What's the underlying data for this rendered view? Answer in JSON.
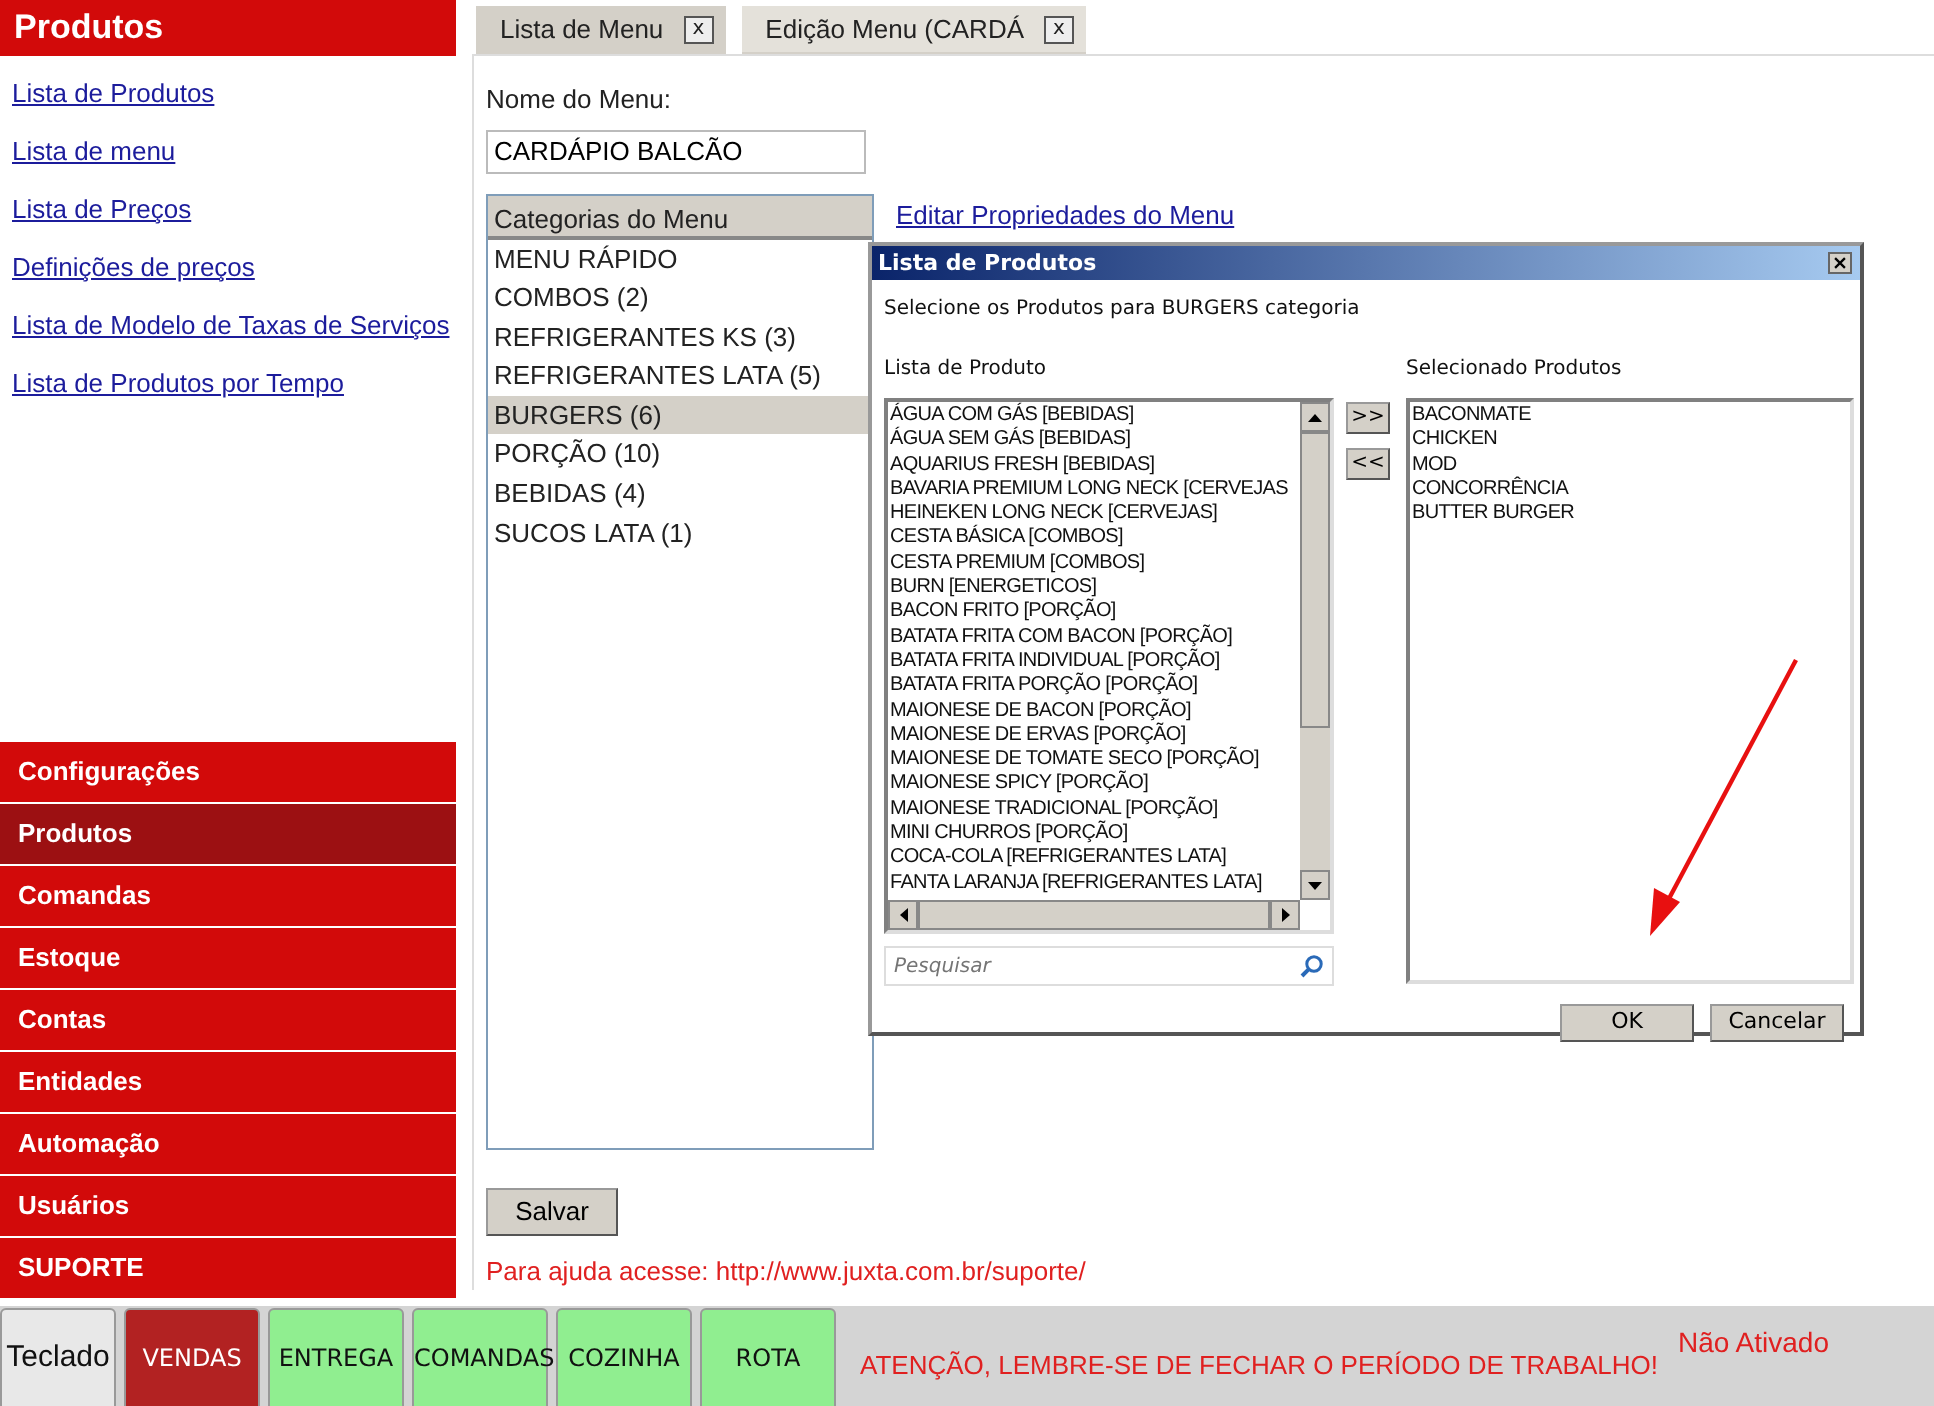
{
  "sidebar": {
    "title": "Produtos",
    "links": [
      "Lista de Produtos",
      "Lista de menu",
      "Lista de Preços",
      "Definições de preços",
      "Lista de Modelo de Taxas de Serviços",
      "Lista de Produtos por Tempo"
    ],
    "sections": [
      {
        "label": "Configurações",
        "selected": false
      },
      {
        "label": "Produtos",
        "selected": true
      },
      {
        "label": "Comandas",
        "selected": false
      },
      {
        "label": "Estoque",
        "selected": false
      },
      {
        "label": "Contas",
        "selected": false
      },
      {
        "label": "Entidades",
        "selected": false
      },
      {
        "label": "Automação",
        "selected": false
      },
      {
        "label": "Usuários",
        "selected": false
      },
      {
        "label": "SUPORTE",
        "selected": false
      }
    ]
  },
  "tabs": [
    {
      "label": "Lista de Menu",
      "close": "x",
      "selected": false
    },
    {
      "label": "Edição Menu (CARDÁ",
      "close": "x",
      "selected": true
    }
  ],
  "form": {
    "name_label": "Nome do Menu:",
    "name_value": "CARDÁPIO BALCÃO",
    "categories_header": "Categorias do Menu",
    "categories": [
      {
        "label": "MENU RÁPIDO",
        "selected": false
      },
      {
        "label": "COMBOS (2)",
        "selected": false
      },
      {
        "label": "REFRIGERANTES KS (3)",
        "selected": false
      },
      {
        "label": "REFRIGERANTES LATA (5)",
        "selected": false
      },
      {
        "label": "BURGERS (6)",
        "selected": true
      },
      {
        "label": "PORÇÃO (10)",
        "selected": false
      },
      {
        "label": "BEBIDAS (4)",
        "selected": false
      },
      {
        "label": "SUCOS LATA (1)",
        "selected": false
      }
    ],
    "edit_link": "Editar Propriedades do Menu",
    "save_button": "Salvar",
    "help_text": "Para ajuda acesse: http://www.juxta.com.br/suporte/"
  },
  "dialog": {
    "title": "Lista de Produtos",
    "instruction": "Selecione os Produtos para BURGERS categoria",
    "available_label": "Lista de Produto",
    "available": [
      "ÁGUA COM GÁS [BEBIDAS]",
      "ÁGUA SEM GÁS [BEBIDAS]",
      "AQUARIUS FRESH [BEBIDAS]",
      "BAVARIA PREMIUM LONG NECK [CERVEJAS",
      "HEINEKEN LONG NECK [CERVEJAS]",
      "CESTA BÁSICA [COMBOS]",
      "CESTA PREMIUM [COMBOS]",
      "BURN [ENERGETICOS]",
      "BACON FRITO [PORÇÃO]",
      "BATATA FRITA COM BACON [PORÇÃO]",
      "BATATA FRITA INDIVIDUAL [PORÇÃO]",
      "BATATA FRITA PORÇÃO [PORÇÃO]",
      "MAIONESE DE BACON [PORÇÃO]",
      "MAIONESE DE ERVAS [PORÇÃO]",
      "MAIONESE DE TOMATE SECO [PORÇÃO]",
      "MAIONESE SPICY [PORÇÃO]",
      "MAIONESE TRADICIONAL [PORÇÃO]",
      "MINI CHURROS [PORÇÃO]",
      "COCA-COLA [REFRIGERANTES LATA]",
      "FANTA LARANJA [REFRIGERANTES LATA]"
    ],
    "add_button": ">>",
    "remove_button": "<<",
    "selected_label": "Selecionado Produtos",
    "selected_products": [
      "BACONMATE",
      "CHICKEN",
      "MOD",
      "CONCORRÊNCIA",
      "BUTTER BURGER"
    ],
    "search": {
      "placeholder": "Pesquisar"
    },
    "ok_button": "OK",
    "cancel_button": "Cancelar"
  },
  "bottom_bar": {
    "buttons": [
      {
        "label": "Teclado",
        "kind": "keyboard",
        "selected": false
      },
      {
        "label": "VENDAS",
        "kind": "module",
        "selected": true
      },
      {
        "label": "ENTREGA",
        "kind": "module",
        "selected": false
      },
      {
        "label": "COMANDAS",
        "kind": "module",
        "selected": false
      },
      {
        "label": "COZINHA",
        "kind": "module",
        "selected": false
      },
      {
        "label": "ROTA",
        "kind": "module",
        "selected": false
      }
    ],
    "warning": "ATENÇÃO, LEMBRE-SE DE FECHAR O PERÍODO DE TRABALHO!",
    "status": "Não Ativado"
  }
}
